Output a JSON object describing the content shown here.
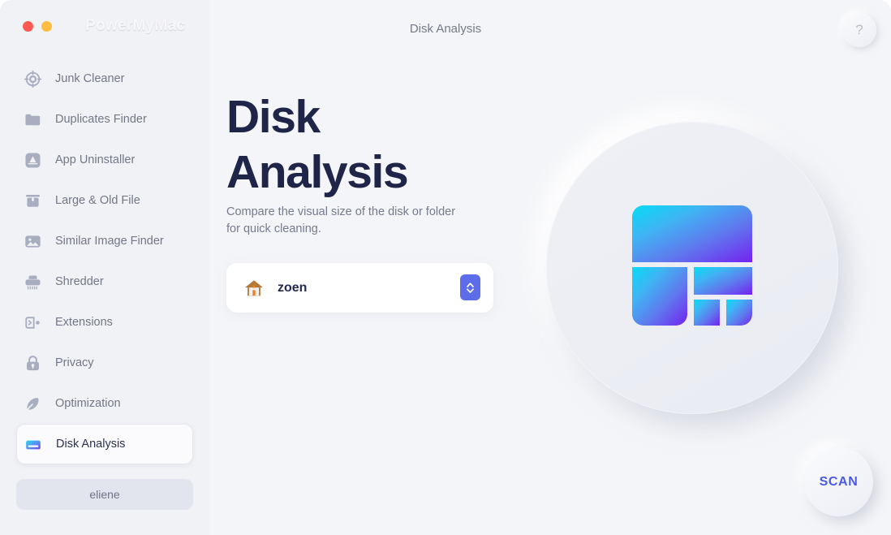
{
  "window": {
    "brand": "PowerMyMac",
    "traffic_lights": [
      {
        "name": "close",
        "color": "#fc5b52"
      },
      {
        "name": "minimize",
        "color": "#fdbd40"
      }
    ],
    "background": "#f4f5f8",
    "sidebar_background": "#f1f2f6"
  },
  "header": {
    "title": "Disk Analysis",
    "help_label": "?"
  },
  "sidebar": {
    "items": [
      {
        "label": "Junk Cleaner",
        "icon": "target-icon",
        "active": false
      },
      {
        "label": "Duplicates Finder",
        "icon": "folder-icon",
        "active": false
      },
      {
        "label": "App Uninstaller",
        "icon": "app-store-icon",
        "active": false
      },
      {
        "label": "Large & Old File",
        "icon": "briefcase-icon",
        "active": false
      },
      {
        "label": "Similar Image Finder",
        "icon": "photo-icon",
        "active": false
      },
      {
        "label": "Shredder",
        "icon": "shredder-icon",
        "active": false
      },
      {
        "label": "Extensions",
        "icon": "plug-icon",
        "active": false
      },
      {
        "label": "Privacy",
        "icon": "lock-icon",
        "active": false
      },
      {
        "label": "Optimization",
        "icon": "rocket-icon",
        "active": false
      },
      {
        "label": "Disk Analysis",
        "icon": "hard-drive-icon",
        "active": true
      }
    ],
    "user_button": "eliene"
  },
  "main": {
    "headline": "Disk\nAnalysis",
    "subtitle": "Compare the visual size of the disk or folder for quick cleaning.",
    "selector": {
      "icon": "house-icon",
      "value": "zoen",
      "stepper_icon": "chevron-up-down-icon"
    },
    "hero_icon": "disk-treemap-icon",
    "scan_button": "SCAN"
  },
  "colors": {
    "accent_blue": "#5d6ce8",
    "scan_text": "#4a5ae6",
    "headline": "#1f2449",
    "muted_text": "#767a8f",
    "icon_gray": "#a9adc0"
  }
}
